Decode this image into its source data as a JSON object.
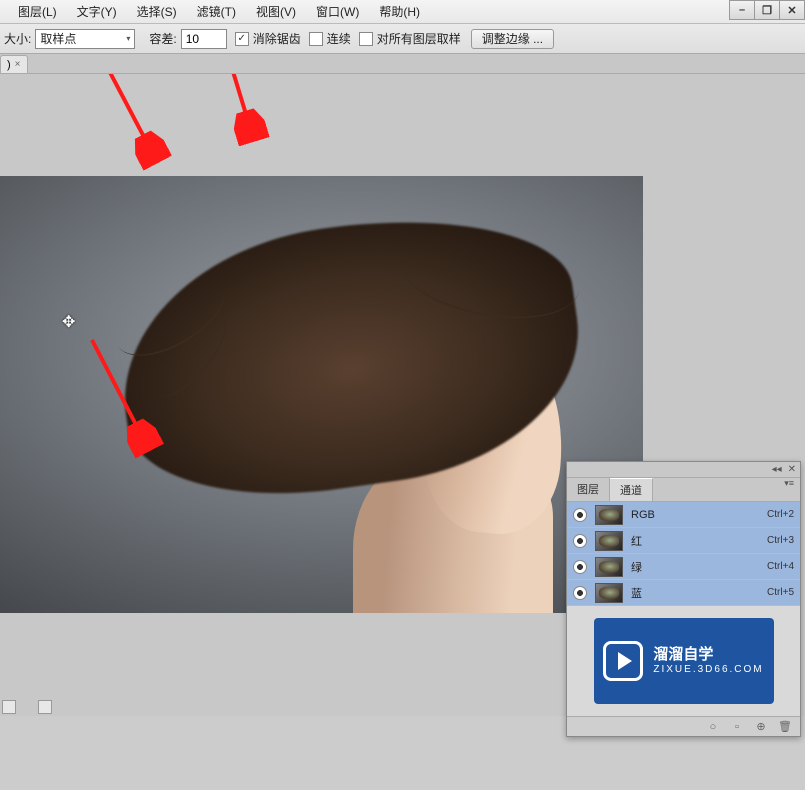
{
  "menu": {
    "items": [
      {
        "label": "图层(L)"
      },
      {
        "label": "文字(Y)"
      },
      {
        "label": "选择(S)"
      },
      {
        "label": "滤镜(T)"
      },
      {
        "label": "视图(V)"
      },
      {
        "label": "窗口(W)"
      },
      {
        "label": "帮助(H)"
      }
    ]
  },
  "window_buttons": {
    "min": "–",
    "max": "❐",
    "close": "✕"
  },
  "options": {
    "size_label": "大小:",
    "size_value": "取样点",
    "tolerance_label": "容差:",
    "tolerance_value": "10",
    "antialias": "消除锯齿",
    "contiguous": "连续",
    "all_layers": "对所有图层取样",
    "refine": "调整边缘 ..."
  },
  "tab": {
    "name": ")",
    "close": "×"
  },
  "panel": {
    "tabs": {
      "layers": "图层",
      "channels": "通道"
    },
    "head": {
      "collapse": "◂◂",
      "close": "✕"
    },
    "menu": "▾≡",
    "channels": [
      {
        "name": "RGB",
        "shortcut": "Ctrl+2"
      },
      {
        "name": "红",
        "shortcut": "Ctrl+3"
      },
      {
        "name": "绿",
        "shortcut": "Ctrl+4"
      },
      {
        "name": "蓝",
        "shortcut": "Ctrl+5"
      }
    ],
    "watermark": {
      "title": "溜溜自学",
      "url": "ZIXUE.3D66.COM"
    },
    "foot": {
      "a": "○",
      "b": "▫",
      "c": "⊕",
      "d": "🗑"
    }
  },
  "cursor_glyph": "✥"
}
